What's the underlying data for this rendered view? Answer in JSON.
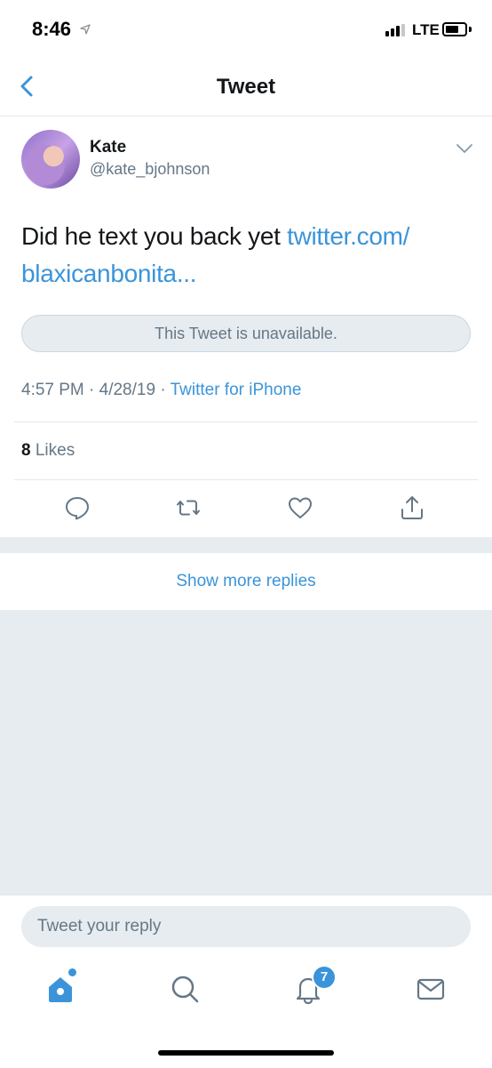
{
  "status_bar": {
    "time": "8:46",
    "network": "LTE"
  },
  "nav": {
    "title": "Tweet",
    "back_icon": "chevron-left-icon"
  },
  "tweet": {
    "author_name": "Kate",
    "author_handle": "@kate_bjohnson",
    "text": "Did he text you back yet ",
    "link_text": "twitter.com/\nblaxicanbonita...",
    "link_part1": "twitter.com/",
    "link_part2": "blaxicanbonita...",
    "quote_unavailable": "This Tweet is unavailable.",
    "timestamp": "4:57 PM · 4/28/19 · ",
    "source": "Twitter for iPhone",
    "likes_count": "8",
    "likes_label": " Likes"
  },
  "actions": [
    "reply-icon",
    "retweet-icon",
    "like-icon",
    "share-icon"
  ],
  "show_more_replies": "Show more replies",
  "composer": {
    "placeholder": "Tweet your reply"
  },
  "tab_bar": {
    "items": [
      "home-icon",
      "search-icon",
      "notifications-icon",
      "messages-icon"
    ],
    "notifications_badge": "7"
  },
  "colors": {
    "accent": "#3b94d9",
    "secondary_text": "#657786",
    "background_gray": "#e6ecf0"
  }
}
